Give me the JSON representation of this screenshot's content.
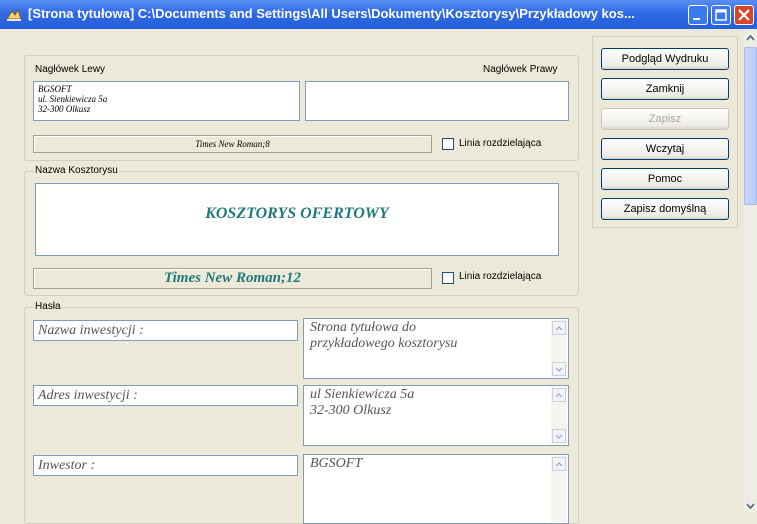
{
  "window": {
    "title": "[Strona tytułowa] C:\\Documents and Settings\\All Users\\Dokumenty\\Kosztorysy\\Przykładowy kos..."
  },
  "header": {
    "left_label": "Nagłówek Lewy",
    "right_label": "Nagłówek Prawy",
    "left_lines": [
      "BGSOFT",
      "ul. Sienkiewicza 5a",
      "32-300 Olkusz"
    ],
    "right_value": "",
    "font": "Times New Roman;8",
    "divider_label": "Linia rozdzielająca"
  },
  "estimate_name": {
    "legend": "Nazwa Kosztorysu",
    "value": "KOSZTORYS OFERTOWY",
    "font": "Times New Roman;12",
    "divider_label": "Linia rozdzielająca",
    "text_color": "#1e7a7a"
  },
  "keywords": {
    "legend": "Hasła",
    "rows": [
      {
        "label": "Nazwa inwestycji :",
        "value": "Strona tytułowa do\nprzykładowego kosztorysu"
      },
      {
        "label": "Adres inwestycji :",
        "value": "ul Sienkiewicza 5a\n32-300 Olkusz"
      },
      {
        "label": "Inwestor :",
        "value": "BGSOFT"
      }
    ]
  },
  "buttons": {
    "print_preview": "Podgląd Wydruku",
    "close": "Zamknij",
    "save": "Zapisz",
    "load": "Wczytaj",
    "help": "Pomoc",
    "save_default": "Zapisz domyślną"
  }
}
